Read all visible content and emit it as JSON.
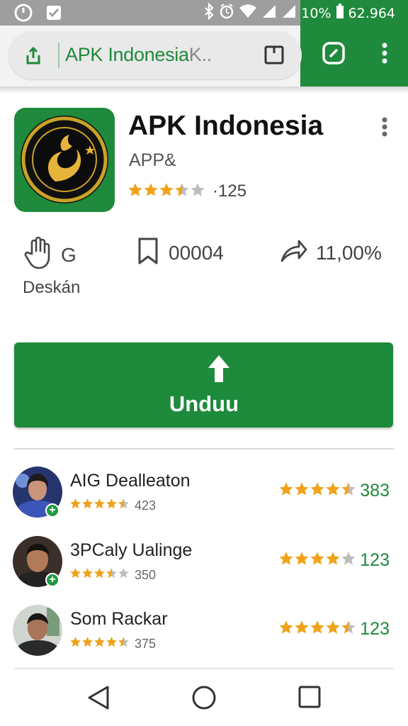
{
  "status_bar": {
    "battery_percent": "10%",
    "clock": "62.964",
    "colors": {
      "left": "#9e9e9e",
      "right": "#1f8a3c"
    }
  },
  "browser": {
    "url_text": "APK Indonesia",
    "url_overflow": "K..",
    "accent": "#1f8a3c"
  },
  "app": {
    "name": "APK Indonesia",
    "developer": "APP&",
    "rating_count": "·125",
    "rating_stars": 3.5,
    "icon_colors": {
      "background": "#1f8a3c",
      "ring": "#c9a227",
      "inner": "#111111"
    }
  },
  "stats": [
    {
      "icon": "hand-icon",
      "value": "G",
      "caption": "Deskán"
    },
    {
      "icon": "bookmark-icon",
      "value": "00004"
    },
    {
      "icon": "share-icon",
      "value": "11,00%"
    }
  ],
  "download_button": {
    "label": "Unduu",
    "color": "#1e8a3b"
  },
  "reviews": [
    {
      "name": "AIG Dealleaton",
      "stars": 4.5,
      "count": "423",
      "right_stars": 4.5,
      "right_value": "383",
      "verified": true
    },
    {
      "name": "3PCaly Ualinge",
      "stars": 3.5,
      "count": "350",
      "right_stars": 4,
      "right_value": "123",
      "verified": true
    },
    {
      "name": "Som Rackar",
      "stars": 4.5,
      "count": "375",
      "right_stars": 4.5,
      "right_value": "123",
      "verified": false
    }
  ],
  "nav": {
    "icons": [
      "back-icon",
      "home-icon",
      "recents-icon"
    ]
  }
}
